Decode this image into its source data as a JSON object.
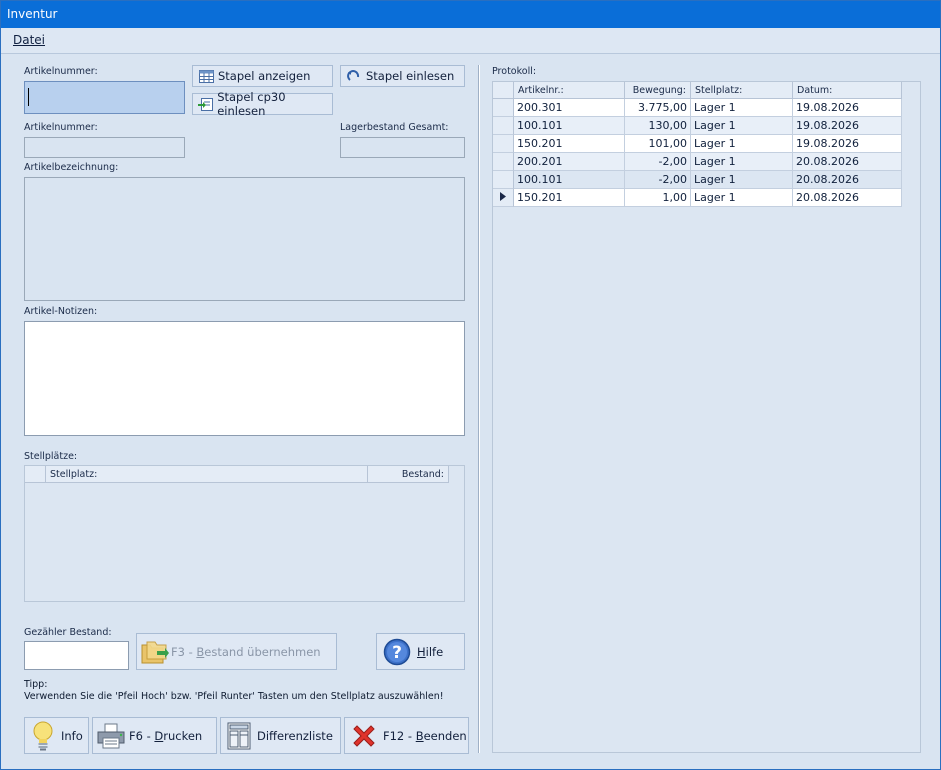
{
  "window": {
    "title": "Inventur"
  },
  "menu": {
    "file": "Datei"
  },
  "left": {
    "artikelnummer_label": "Artikelnummer:",
    "artikelnummer2_label": "Artikelnummer:",
    "lagerbestand_label": "Lagerbestand Gesamt:",
    "bezeichnung_label": "Artikelbezeichnung:",
    "notizen_label": "Artikel-Notizen:",
    "stellplaetze_label": "Stellplätze:",
    "stellplatz_col": "Stellplatz:",
    "bestand_col": "Bestand:",
    "gezaehlt_label": "Gezähler Bestand:",
    "tipp_label": "Tipp:",
    "tipp_text": "Verwenden Sie die 'Pfeil Hoch' bzw. 'Pfeil Runter' Tasten um den Stellplatz auszuwählen!"
  },
  "buttons": {
    "stapel_anzeigen": "Stapel anzeigen",
    "stapel_einlesen": "Stapel einlesen",
    "stapel_cp30": "Stapel cp30 einlesen",
    "bestand_uebernehmen_prefix": "F3 - ",
    "bestand_uebernehmen_key": "B",
    "bestand_uebernehmen_rest": "estand übernehmen",
    "hilfe_key": "H",
    "hilfe_rest": "ilfe",
    "info": "Info",
    "drucken_prefix": "F6 - ",
    "drucken_key": "D",
    "drucken_rest": "rucken",
    "differenzliste": "Differenzliste",
    "beenden_prefix": "F12 - ",
    "beenden_key": "B",
    "beenden_rest": "eenden"
  },
  "protokoll": {
    "label": "Protokoll:",
    "columns": [
      "Artikelnr.:",
      "Bewegung:",
      "Stellplatz:",
      "Datum:"
    ],
    "rows": [
      {
        "artikelnr": "200.301",
        "bewegung": "3.775,00",
        "stellplatz": "Lager 1",
        "datum": "19.08.2026"
      },
      {
        "artikelnr": "100.101",
        "bewegung": "130,00",
        "stellplatz": "Lager 1",
        "datum": "19.08.2026"
      },
      {
        "artikelnr": "150.201",
        "bewegung": "101,00",
        "stellplatz": "Lager 1",
        "datum": "19.08.2026"
      },
      {
        "artikelnr": "200.201",
        "bewegung": "-2,00",
        "stellplatz": "Lager 1",
        "datum": "20.08.2026"
      },
      {
        "artikelnr": "100.101",
        "bewegung": "-2,00",
        "stellplatz": "Lager 1",
        "datum": "20.08.2026"
      },
      {
        "artikelnr": "150.201",
        "bewegung": "1,00",
        "stellplatz": "Lager 1",
        "datum": "20.08.2026"
      }
    ]
  }
}
